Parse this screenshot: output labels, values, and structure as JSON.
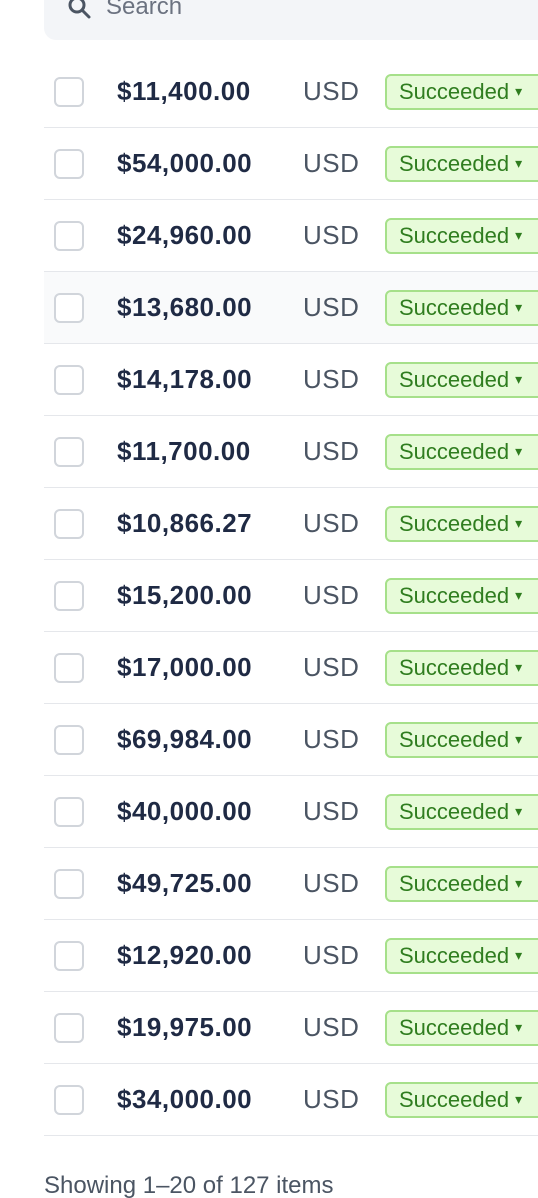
{
  "search": {
    "placeholder": "Search"
  },
  "rows": [
    {
      "amount": "$11,400.00",
      "currency": "USD",
      "status": "Succeeded"
    },
    {
      "amount": "$54,000.00",
      "currency": "USD",
      "status": "Succeeded"
    },
    {
      "amount": "$24,960.00",
      "currency": "USD",
      "status": "Succeeded"
    },
    {
      "amount": "$13,680.00",
      "currency": "USD",
      "status": "Succeeded"
    },
    {
      "amount": "$14,178.00",
      "currency": "USD",
      "status": "Succeeded"
    },
    {
      "amount": "$11,700.00",
      "currency": "USD",
      "status": "Succeeded"
    },
    {
      "amount": "$10,866.27",
      "currency": "USD",
      "status": "Succeeded"
    },
    {
      "amount": "$15,200.00",
      "currency": "USD",
      "status": "Succeeded"
    },
    {
      "amount": "$17,000.00",
      "currency": "USD",
      "status": "Succeeded"
    },
    {
      "amount": "$69,984.00",
      "currency": "USD",
      "status": "Succeeded"
    },
    {
      "amount": "$40,000.00",
      "currency": "USD",
      "status": "Succeeded"
    },
    {
      "amount": "$49,725.00",
      "currency": "USD",
      "status": "Succeeded"
    },
    {
      "amount": "$12,920.00",
      "currency": "USD",
      "status": "Succeeded"
    },
    {
      "amount": "$19,975.00",
      "currency": "USD",
      "status": "Succeeded"
    },
    {
      "amount": "$34,000.00",
      "currency": "USD",
      "status": "Succeeded"
    }
  ],
  "highlighted_row": 3,
  "footer": {
    "summary": "Showing 1–20 of 127 items"
  },
  "colors": {
    "status_bg": "#e7fbd9",
    "status_border": "#a6e08a",
    "status_text": "#2f7d1f"
  },
  "icons": {
    "search": "search-icon",
    "dropdown": "chevron-down-icon"
  }
}
